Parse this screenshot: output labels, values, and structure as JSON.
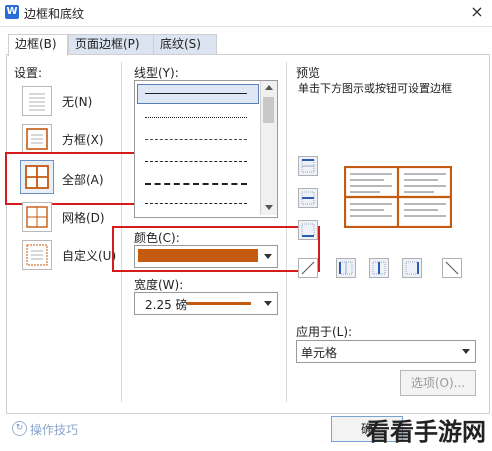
{
  "window": {
    "title": "边框和底纹",
    "app_icon_letter": "W",
    "close_glyph": "×"
  },
  "tabs": [
    {
      "label": "边框(B)",
      "active": true
    },
    {
      "label": "页面边框(P)",
      "active": false
    },
    {
      "label": "底纹(S)",
      "active": false
    }
  ],
  "settings": {
    "heading": "设置:",
    "options": [
      {
        "label": "无(N)",
        "icon": "no-border-icon"
      },
      {
        "label": "方框(X)",
        "icon": "box-border-icon"
      },
      {
        "label": "全部(A)",
        "icon": "all-borders-icon",
        "selected": true
      },
      {
        "label": "网格(D)",
        "icon": "grid-border-icon"
      },
      {
        "label": "自定义(U)",
        "icon": "custom-border-icon"
      }
    ]
  },
  "line_style": {
    "label": "线型(Y):"
  },
  "color": {
    "label": "颜色(C):",
    "value_hex": "#c55a11"
  },
  "width": {
    "label": "宽度(W):",
    "value": "2.25 磅"
  },
  "preview": {
    "heading": "预览",
    "hint": "单击下方图示或按钮可设置边框"
  },
  "apply_to": {
    "label": "应用于(L):",
    "value": "单元格"
  },
  "options_button": {
    "label": "选项(O)..."
  },
  "tips": {
    "label": "操作技巧"
  },
  "ok_button": {
    "label": "确"
  },
  "watermark": {
    "text": "看看手游网"
  },
  "colors": {
    "accent": "#c55a11",
    "highlight": "#d61b1b",
    "tab_bg": "#dbe4f0"
  }
}
